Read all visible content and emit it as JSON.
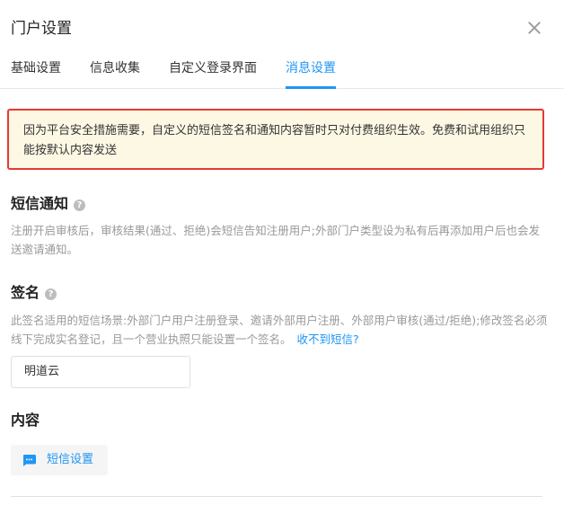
{
  "dialog": {
    "title": "门户设置"
  },
  "tabs": [
    {
      "label": "基础设置",
      "active": false
    },
    {
      "label": "信息收集",
      "active": false
    },
    {
      "label": "自定义登录界面",
      "active": false
    },
    {
      "label": "消息设置",
      "active": true
    }
  ],
  "notice": {
    "text": "因为平台安全措施需要，自定义的短信签名和通知内容暂时只对付费组织生效。免费和试用组织只能按默认内容发送"
  },
  "sms_notification": {
    "title": "短信通知",
    "description": "注册开启审核后，审核结果(通过、拒绝)会短信告知注册用户;外部门户类型设为私有后再添加用户后也会发送邀请通知。"
  },
  "signature": {
    "title": "签名",
    "description": "此签名适用的短信场景:外部门户用户注册登录、邀请外部用户注册、外部用户审核(通过/拒绝);修改签名必须线下完成实名登记，且一个营业执照只能设置一个签名。",
    "link_text": "收不到短信?",
    "value": "明道云"
  },
  "content": {
    "title": "内容",
    "button_label": "短信设置"
  },
  "icons": {
    "close": "close-icon",
    "help": "question-circle-icon",
    "chat": "message-icon"
  },
  "colors": {
    "accent": "#2196f3",
    "notice_bg": "#fdf8e4",
    "notice_border": "#e53935",
    "muted_text": "#999999"
  }
}
